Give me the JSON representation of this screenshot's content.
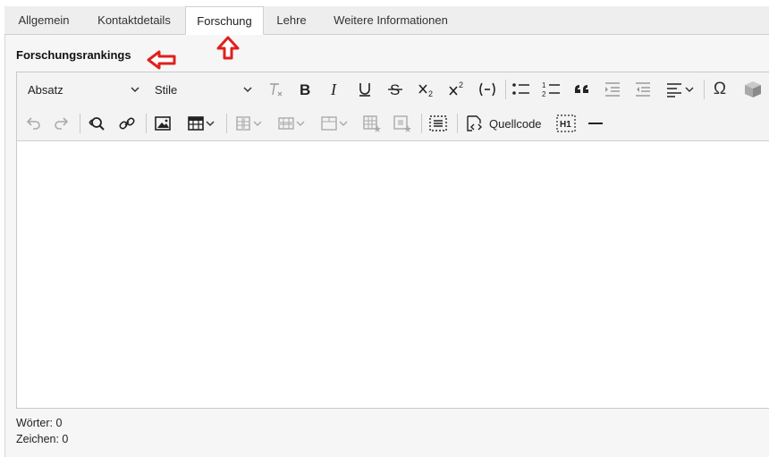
{
  "tabs": [
    {
      "label": "Allgemein"
    },
    {
      "label": "Kontaktdetails"
    },
    {
      "label": "Forschung"
    },
    {
      "label": "Lehre"
    },
    {
      "label": "Weitere Informationen"
    }
  ],
  "field": {
    "label": "Forschungsrankings"
  },
  "toolbar": {
    "paragraph_format": "Absatz",
    "styles": "Stile",
    "source_label": "Quellcode",
    "special_char": "Ω",
    "heading_badge": "H1"
  },
  "status": {
    "words": "Wörter: 0",
    "chars": "Zeichen: 0"
  },
  "colors": {
    "arrow": "#e0201b",
    "tab_bg": "#eeeeee",
    "toolbar_bg": "#f3f3f3"
  }
}
